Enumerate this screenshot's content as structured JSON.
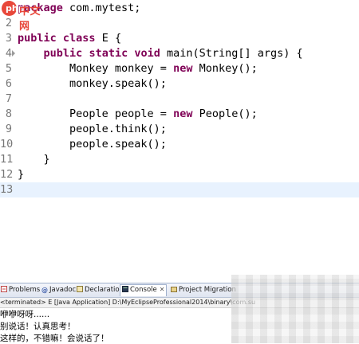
{
  "watermark": {
    "text": "php中文网",
    "color": "#e8483b"
  },
  "editor": {
    "lines": [
      {
        "num": "1",
        "text": "package com.mytest;"
      },
      {
        "num": "2",
        "text": ""
      },
      {
        "num": "3",
        "text": "public class E {"
      },
      {
        "num": "4",
        "text": "    public static void main(String[] args) {"
      },
      {
        "num": "5",
        "text": "        Monkey monkey = new Monkey();"
      },
      {
        "num": "6",
        "text": "        monkey.speak();"
      },
      {
        "num": "7",
        "text": ""
      },
      {
        "num": "8",
        "text": "        People people = new People();"
      },
      {
        "num": "9",
        "text": "        people.think();"
      },
      {
        "num": "10",
        "text": "        people.speak();"
      },
      {
        "num": "11",
        "text": "    }"
      },
      {
        "num": "12",
        "text": "}"
      },
      {
        "num": "13",
        "text": ""
      }
    ],
    "current_line": "13",
    "keyword_color": "#7f0055"
  },
  "views": {
    "tabs": [
      {
        "label": "Problems",
        "icon": "problems-icon"
      },
      {
        "label": "Javadoc",
        "icon": "javadoc-icon"
      },
      {
        "label": "Declaration",
        "icon": "declaration-icon"
      },
      {
        "label": "Console",
        "icon": "console-icon",
        "active": true
      },
      {
        "label": "Project Migration",
        "icon": "project-migration-icon"
      }
    ]
  },
  "console": {
    "status": "<terminated> E [Java Application] D:\\MyEclipseProfessional2014\\binary\\com.su",
    "output": [
      "咿咿呀呀......",
      "别说话！认真思考！",
      "这样的，不错嘛！会说话了！"
    ]
  }
}
